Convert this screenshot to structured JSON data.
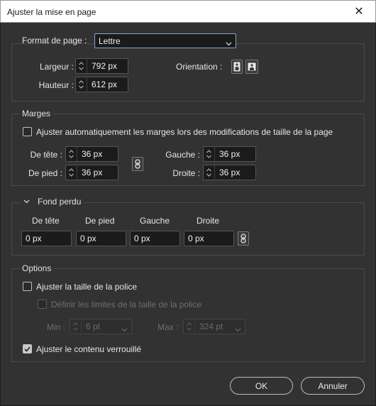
{
  "window": {
    "title": "Ajuster la mise en page",
    "close_glyph": "✕"
  },
  "page_format": {
    "label": "Format de page :",
    "selected": "Lettre",
    "width_label": "Largeur :",
    "width_value": "792 px",
    "height_label": "Hauteur :",
    "height_value": "612 px",
    "orientation_label": "Orientation :"
  },
  "margins": {
    "legend": "Marges",
    "auto_adjust_label": "Ajuster automatiquement les marges lors des modifications de taille de la page",
    "auto_adjust_checked": false,
    "top_label": "De tête :",
    "top_value": "36 px",
    "bottom_label": "De pied :",
    "bottom_value": "36 px",
    "left_label": "Gauche :",
    "left_value": "36 px",
    "right_label": "Droite :",
    "right_value": "36 px"
  },
  "bleed": {
    "legend": "Fond perdu",
    "headers": [
      "De tête",
      "De pied",
      "Gauche",
      "Droite"
    ],
    "values": [
      "0 px",
      "0 px",
      "0 px",
      "0 px"
    ]
  },
  "options": {
    "legend": "Options",
    "font_size_label": "Ajuster la taille de la police",
    "font_size_checked": false,
    "font_limits_label": "Définir les limites de la taille de la police",
    "min_label": "Min :",
    "min_value": "6 pt",
    "max_label": "Max :",
    "max_value": "324 pt",
    "locked_label": "Ajuster le contenu verrouillé",
    "locked_checked": true
  },
  "buttons": {
    "ok": "OK",
    "cancel": "Annuler"
  },
  "icons": {
    "portrait": "portrait-orientation-icon",
    "landscape": "landscape-orientation-icon",
    "link": "chain-link-icon",
    "chevron": "chevron-down-icon",
    "check": "checkmark-icon"
  }
}
